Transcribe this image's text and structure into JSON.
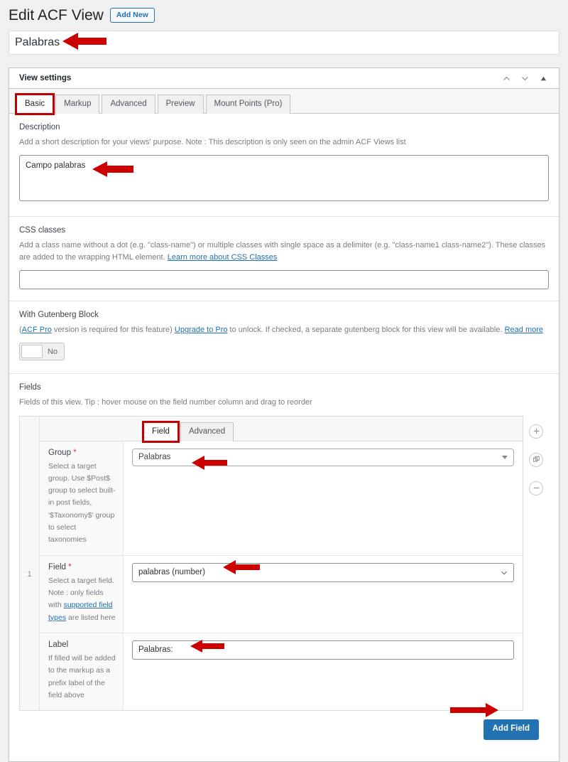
{
  "header": {
    "title": "Edit ACF View",
    "add_new_label": "Add New"
  },
  "title_field": {
    "value": "Palabras"
  },
  "panel": {
    "title": "View settings",
    "actions": {
      "move_up": "chevron-up-icon",
      "move_down": "chevron-down-icon",
      "collapse": "toggle-panel-icon"
    },
    "tabs": [
      {
        "label": "Basic",
        "active": true
      },
      {
        "label": "Markup",
        "active": false
      },
      {
        "label": "Advanced",
        "active": false
      },
      {
        "label": "Preview",
        "active": false
      },
      {
        "label": "Mount Points (Pro)",
        "active": false
      }
    ]
  },
  "description_section": {
    "label": "Description",
    "help": "Add a short description for your views' purpose. Note : This description is only seen on the admin ACF Views list",
    "value": "Campo palabras"
  },
  "css_section": {
    "label": "CSS classes",
    "help_part1": "Add a class name without a dot (e.g. \"class-name\") or multiple classes with single space as a delimiter (e.g. \"class-name1 class-name2\"). These classes are added to the wrapping HTML element. ",
    "help_link": "Learn more about CSS Classes",
    "value": "",
    "placeholder": ""
  },
  "gutenberg_section": {
    "label": "With Gutenberg Block",
    "help_open_paren": "(",
    "help_link1": "ACF Pro",
    "help_mid1": " version is required for this feature) ",
    "help_link2": "Upgrade to Pro",
    "help_mid2": " to unlock. If checked, a separate gutenberg block for this view will be available. ",
    "help_link3": "Read more",
    "toggle_value": "No"
  },
  "fields_section": {
    "label": "Fields",
    "help": "Fields of this view. Tip : hover mouse on the field number column and drag to reorder",
    "row_number": "1",
    "tabs": [
      {
        "label": "Field",
        "active": true
      },
      {
        "label": "Advanced",
        "active": false
      }
    ],
    "rows": [
      {
        "title": "Group",
        "required": "*",
        "help": "Select a target group. Use $Post$ group to select built-in post fields, '$Taxonomy$' group to select taxonomies",
        "control": "select2",
        "value": "Palabras"
      },
      {
        "title": "Field",
        "required": "*",
        "help_pre": "Select a target field. Note : only fields with ",
        "help_link": "supported field types",
        "help_post": " are listed here",
        "control": "select",
        "value": "palabras (number)"
      },
      {
        "title": "Label",
        "required": "",
        "help": "If filled will be added to the markup as a prefix label of the field above",
        "control": "text",
        "value": "Palabras:"
      }
    ],
    "side_actions": [
      {
        "icon": "plus-circle-icon"
      },
      {
        "icon": "duplicate-icon"
      },
      {
        "icon": "minus-circle-icon"
      }
    ],
    "add_field_label": "Add Field"
  },
  "annotations": {
    "color": "#cc0000",
    "arrows": [
      {
        "name": "arrow-to-title-input"
      },
      {
        "name": "arrow-to-description-textarea"
      },
      {
        "name": "arrow-to-group-select"
      },
      {
        "name": "arrow-to-field-select"
      },
      {
        "name": "arrow-to-label-input"
      },
      {
        "name": "arrow-to-add-field-button"
      }
    ],
    "highlights": [
      {
        "name": "highlight-basic-tab"
      },
      {
        "name": "highlight-field-tab"
      }
    ]
  }
}
